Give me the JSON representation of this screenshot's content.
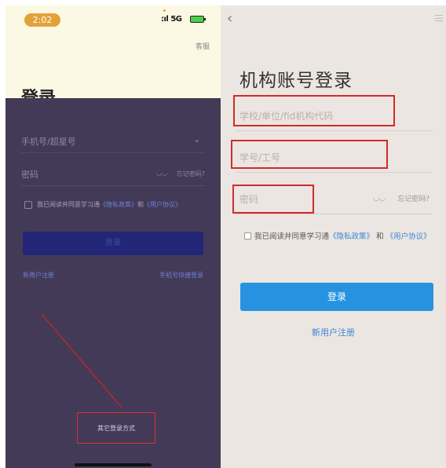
{
  "left": {
    "status_time": "2:02",
    "status_signal": "5G",
    "service": "客服",
    "title": "登录",
    "phone_placeholder": "手机号/超星号",
    "password_placeholder": "密码",
    "forgot": "忘记密码?",
    "agree_prefix": "我已阅读并同意学习通",
    "privacy_link": "《隐私政策》",
    "and": "和",
    "user_link": "《用户协议》",
    "login_button": "登录",
    "register_link": "新用户注册",
    "phone_login_link": "手机号快捷登录",
    "other_login": "其它登录方式"
  },
  "right": {
    "title": "机构账号登录",
    "school_placeholder": "学校/单位/fid机构代码",
    "id_placeholder": "学号/工号",
    "password_placeholder": "密码",
    "forgot": "忘记密码?",
    "agree_prefix": "我已阅读并同意学习通",
    "privacy_link": "《隐私政策》",
    "and": "和",
    "user_link": "《用户协议》",
    "login_button": "登录",
    "register_link": "新用户注册"
  },
  "colors": {
    "highlight": "#d42a2a",
    "primary_blue": "#2793e0",
    "overlay": "#433a57"
  },
  "icons": [
    "back-icon",
    "menu-icon",
    "eye-closed-icon",
    "chevron-down-icon",
    "battery-icon",
    "signal-icon"
  ]
}
